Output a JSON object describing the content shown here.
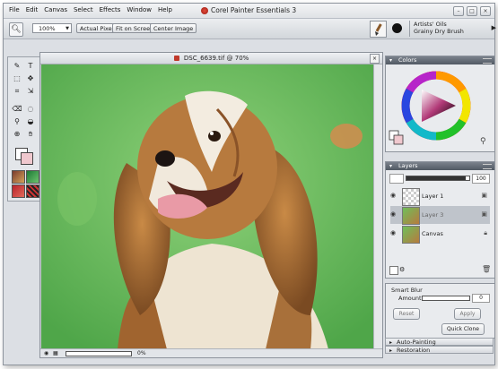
{
  "app": {
    "title": "Corel Painter Essentials 3"
  },
  "menu": [
    "File",
    "Edit",
    "Canvas",
    "Select",
    "Effects",
    "Window",
    "Help"
  ],
  "window_controls": {
    "minimize": "–",
    "maximize": "□",
    "close": "×"
  },
  "toolbar": {
    "zoom_value": "100%",
    "actual_pixels": "Actual Pixels",
    "fit_on_screen": "Fit on Screen",
    "center_image": "Center Image"
  },
  "brush": {
    "category": "Artists' Oils",
    "variant": "Grainy Dry Brush"
  },
  "document": {
    "title": "DSC_6639.tif @ 70%",
    "status_zoom": "0%",
    "close": "×"
  },
  "colors_panel": {
    "title": "Colors",
    "fg_color": "#ffffff",
    "bg_color": "#f0c8ce"
  },
  "layers_panel": {
    "title": "Layers",
    "opacity": "100",
    "layers": [
      {
        "name": "Layer 1",
        "visible": true,
        "selected": false
      },
      {
        "name": "Layer 3",
        "visible": true,
        "selected": true
      },
      {
        "name": "Canvas",
        "visible": true,
        "selected": false
      }
    ]
  },
  "smart_blur_panel": {
    "title": "Smart Blur",
    "amount_label": "Amount",
    "amount_value": "0",
    "reset": "Reset",
    "apply": "Apply",
    "quick_clone": "Quick Clone"
  },
  "collapsed_panels": [
    "Auto-Painting",
    "Restoration"
  ]
}
